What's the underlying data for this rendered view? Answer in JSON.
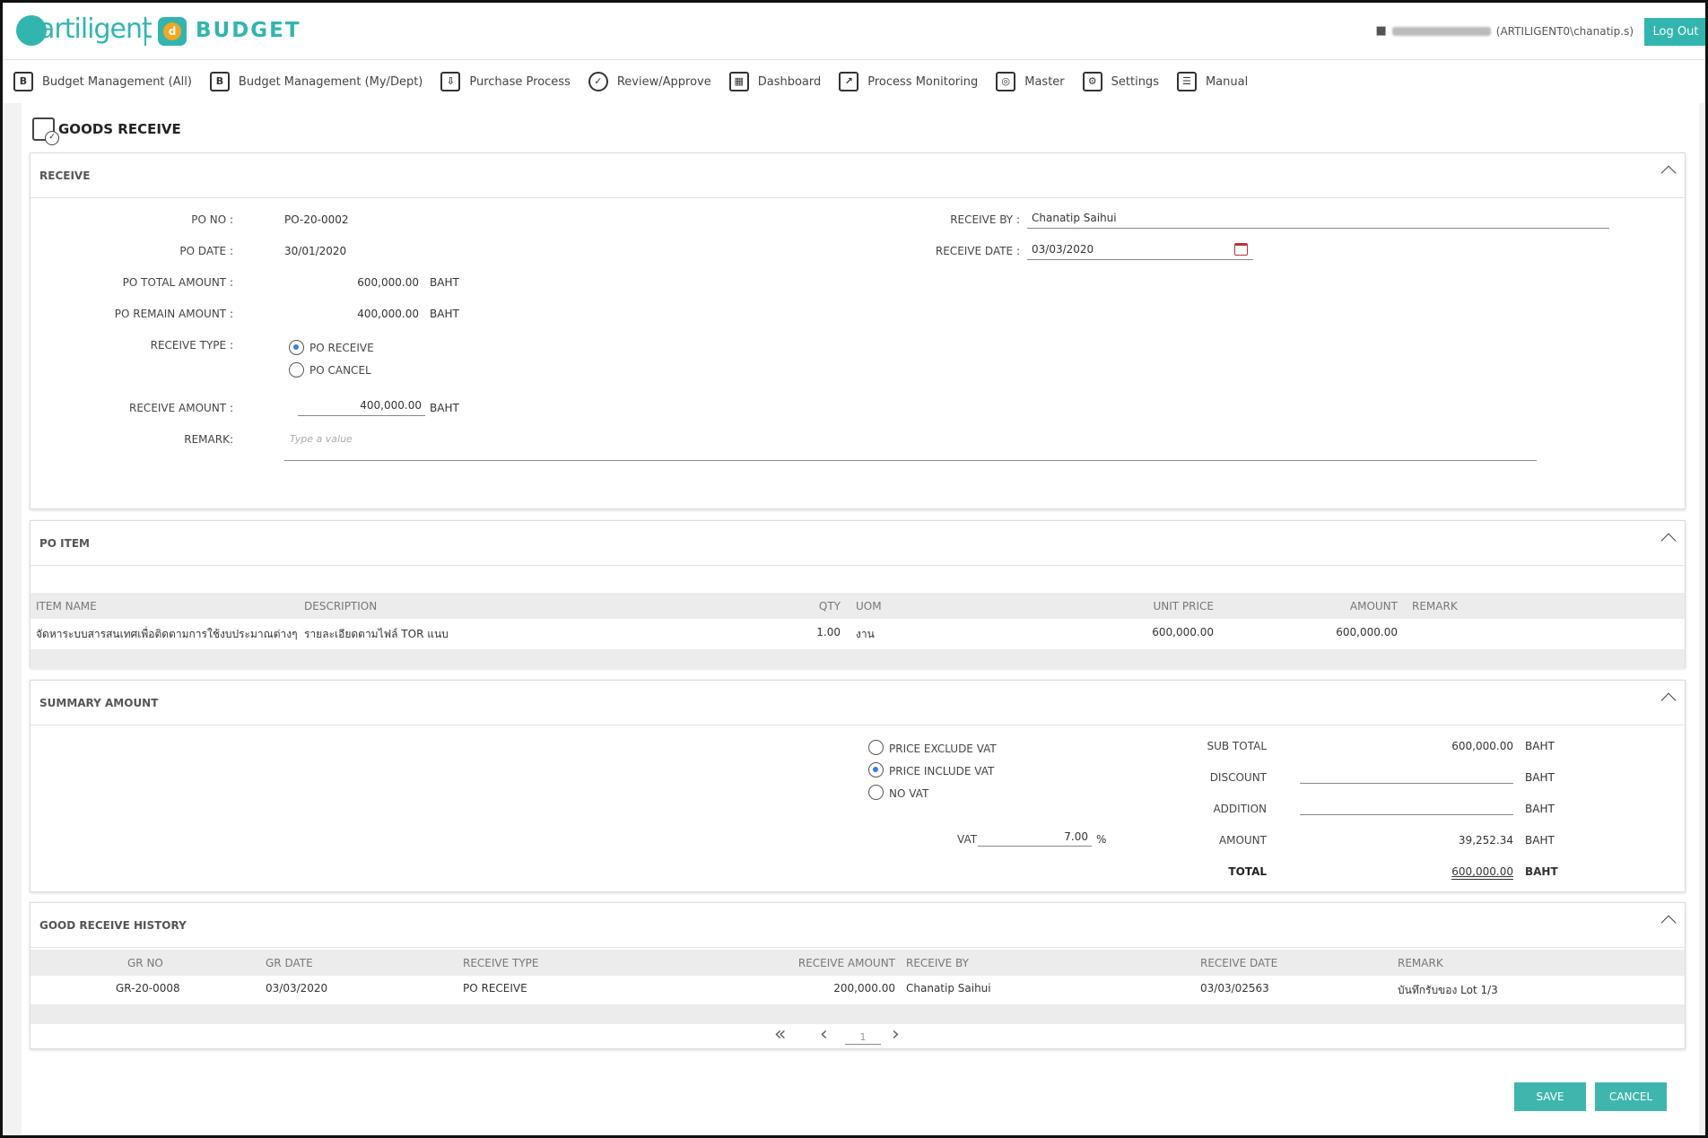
{
  "header": {
    "logo_text": "artiligent",
    "app_badge": "d",
    "app_name": "BUDGET",
    "user_domain": "(ARTILIGENT0\\chanatip.s)",
    "logout": "Log Out"
  },
  "nav": [
    {
      "label": "Budget Management (All)",
      "icon": "B"
    },
    {
      "label": "Budget Management (My/Dept)",
      "icon": "B"
    },
    {
      "label": "Purchase Process",
      "icon": "⇩"
    },
    {
      "label": "Review/Approve",
      "icon": "✓"
    },
    {
      "label": "Dashboard",
      "icon": "▦"
    },
    {
      "label": "Process Monitoring",
      "icon": "↗"
    },
    {
      "label": "Master",
      "icon": "◎"
    },
    {
      "label": "Settings",
      "icon": "⚙"
    },
    {
      "label": "Manual",
      "icon": "☰"
    }
  ],
  "page_title": "GOODS RECEIVE",
  "receive": {
    "title": "RECEIVE",
    "po_no_label": "PO NO :",
    "po_no": "PO-20-0002",
    "po_date_label": "PO DATE :",
    "po_date": "30/01/2020",
    "po_total_label": "PO TOTAL AMOUNT :",
    "po_total": "600,000.00",
    "po_remain_label": "PO REMAIN AMOUNT :",
    "po_remain": "400,000.00",
    "currency": "BAHT",
    "receive_type_label": "RECEIVE TYPE :",
    "type_receive": "PO RECEIVE",
    "type_cancel": "PO CANCEL",
    "receive_amount_label": "RECEIVE AMOUNT :",
    "receive_amount": "400,000.00",
    "remark_label": "REMARK:",
    "remark_placeholder": "Type a value",
    "receive_by_label": "RECEIVE BY :",
    "receive_by": "Chanatip Saihui",
    "receive_date_label": "RECEIVE DATE :",
    "receive_date": "03/03/2020"
  },
  "po_item": {
    "title": "PO ITEM",
    "columns": [
      "ITEM NAME",
      "DESCRIPTION",
      "QTY",
      "UOM",
      "UNIT PRICE",
      "AMOUNT",
      "REMARK"
    ],
    "row": {
      "item_name": "จัดหาระบบสารสนเทศเพื่อติดตามการใช้งบประมาณต่างๆ",
      "description": "รายละเอียดตามไฟล์ TOR แนบ",
      "qty": "1.00",
      "uom": "งาน",
      "unit_price": "600,000.00",
      "amount": "600,000.00",
      "remark": ""
    }
  },
  "summary": {
    "title": "SUMMARY AMOUNT",
    "opt_exclude": "PRICE EXCLUDE VAT",
    "opt_include": "PRICE INCLUDE VAT",
    "opt_novat": "NO VAT",
    "vat_label": "VAT",
    "vat_value": "7.00",
    "vat_unit": "%",
    "sub_total_label": "SUB TOTAL",
    "sub_total": "600,000.00",
    "discount_label": "DISCOUNT",
    "addition_label": "ADDITION",
    "amount_label": "AMOUNT",
    "amount": "39,252.34",
    "total_label": "TOTAL",
    "total": "600,000.00",
    "currency": "BAHT"
  },
  "history": {
    "title": "GOOD RECEIVE HISTORY",
    "columns": [
      "GR NO",
      "GR DATE",
      "RECEIVE TYPE",
      "RECEIVE AMOUNT",
      "RECEIVE BY",
      "RECEIVE DATE",
      "REMARK"
    ],
    "row": {
      "gr_no": "GR-20-0008",
      "gr_date": "03/03/2020",
      "receive_type": "PO RECEIVE",
      "receive_amount": "200,000.00",
      "receive_by": "Chanatip Saihui",
      "receive_date": "03/03/02563",
      "remark": "บันทึกรับของ Lot 1/3"
    },
    "page": "1"
  },
  "actions": {
    "save": "SAVE",
    "cancel": "CANCEL"
  },
  "colors": {
    "accent": "#32b5ae",
    "radio_dot": "#3b7ddd"
  }
}
